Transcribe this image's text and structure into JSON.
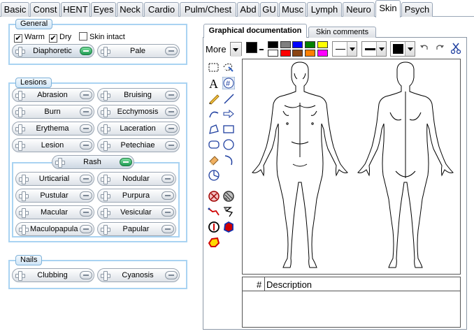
{
  "tabs": [
    "Basic",
    "Const",
    "HENT",
    "Eyes",
    "Neck",
    "Cardio",
    "Pulm/Chest",
    "Abd",
    "GU",
    "Musc",
    "Lymph",
    "Neuro",
    "Skin",
    "Psych"
  ],
  "active_tab": "Skin",
  "general": {
    "title": "General",
    "checkboxes": [
      {
        "label": "Warm",
        "checked": true
      },
      {
        "label": "Dry",
        "checked": true
      },
      {
        "label": "Skin intact",
        "checked": false
      }
    ],
    "buttons": [
      "Diaphoretic",
      "Pale"
    ]
  },
  "lesions": {
    "title": "Lesions",
    "buttons": [
      "Abrasion",
      "Bruising",
      "Burn",
      "Ecchymosis",
      "Erythema",
      "Laceration",
      "Lesion",
      "Petechiae"
    ],
    "rash": {
      "label": "Rash",
      "buttons": [
        "Urticarial",
        "Nodular",
        "Pustular",
        "Purpura",
        "Macular",
        "Vesicular",
        "Maculopapular",
        "Papular"
      ]
    }
  },
  "nails": {
    "title": "Nails",
    "buttons": [
      "Clubbing",
      "Cyanosis"
    ]
  },
  "graphical": {
    "tabs": [
      "Graphical documentation",
      "Skin comments"
    ],
    "more_label": "More",
    "colors": {
      "current": "#000000",
      "palette": [
        "#000000",
        "#7f7f7f",
        "#0000ff",
        "#008000",
        "#ffff00",
        "#ffffff",
        "#ff0000",
        "#8b4513",
        "#ff8000",
        "#ff00ff"
      ]
    },
    "icons": [
      "select-rect-icon",
      "select-lasso-icon",
      "text-icon",
      "number-icon",
      "pencil-icon",
      "line-icon",
      "curve-icon",
      "arrow-icon",
      "polygon-icon",
      "rectangle-icon",
      "rounded-rect-icon",
      "ellipse-icon",
      "eraser-icon",
      "arc-icon",
      "pie-icon",
      "stamp-cross-icon",
      "stamp-hatch-icon",
      "stamp-line-icon",
      "stamp-spike-icon",
      "stamp-circle-icon",
      "stamp-blob-icon",
      "stamp-star-icon"
    ],
    "description_table": {
      "columns": [
        "#",
        "Description"
      ]
    }
  }
}
